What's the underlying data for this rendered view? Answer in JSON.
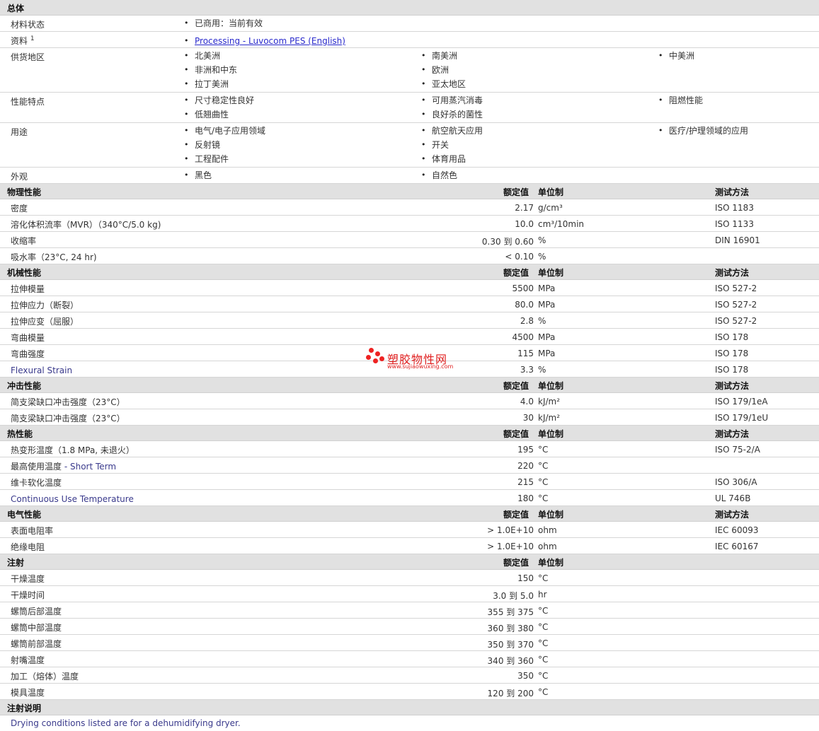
{
  "general": {
    "title": "总体",
    "status_label": "材料状态",
    "status_value": "已商用：当前有效",
    "docs_label": "资料",
    "docs_sup": "1",
    "docs_link": "Processing - Luvocom PES (English)",
    "supply_label": "供货地区",
    "supply": [
      "北美洲",
      "南美洲",
      "中美洲",
      "非洲和中东",
      "欧洲",
      "拉丁美洲",
      "亚太地区"
    ],
    "features_label": "性能特点",
    "features": [
      "尺寸稳定性良好",
      "可用蒸汽消毒",
      "阻燃性能",
      "低翘曲性",
      "良好杀的菌性"
    ],
    "uses_label": "用途",
    "uses": [
      "电气/电子应用领域",
      "航空航天应用",
      "医疗/护理领域的应用",
      "反射镜",
      "开关",
      "工程配件",
      "体育用品"
    ],
    "appearance_label": "外观",
    "appearance": [
      "黑色",
      "自然色"
    ]
  },
  "headers": {
    "nominal": "额定值",
    "unit": "单位制",
    "test": "测试方法"
  },
  "physical": {
    "title": "物理性能",
    "rows": [
      {
        "label": "密度",
        "value": "2.17",
        "unit": "g/cm³",
        "test": "ISO 1183"
      },
      {
        "label": "溶化体积流率（MVR）（340°C/5.0 kg)",
        "value": "10.0",
        "unit": "cm³/10min",
        "test": "ISO 1133"
      },
      {
        "label": "收缩率",
        "value": "0.30 到  0.60",
        "unit": "%",
        "test": "DIN 16901"
      },
      {
        "label": "吸水率（23°C, 24 hr)",
        "value": "< 0.10",
        "unit": "%",
        "test": ""
      }
    ]
  },
  "mechanical": {
    "title": "机械性能",
    "rows": [
      {
        "label": "拉伸模量",
        "value": "5500",
        "unit": "MPa",
        "test": "ISO 527-2"
      },
      {
        "label": "拉伸应力（断裂）",
        "value": "80.0",
        "unit": "MPa",
        "test": "ISO 527-2"
      },
      {
        "label": "拉伸应变（屈服）",
        "value": "2.8",
        "unit": "%",
        "test": "ISO 527-2"
      },
      {
        "label": "弯曲模量",
        "value": "4500",
        "unit": "MPa",
        "test": "ISO 178"
      },
      {
        "label": "弯曲强度",
        "value": "115",
        "unit": "MPa",
        "test": "ISO 178"
      },
      {
        "label": "Flexural Strain",
        "value": "3.3",
        "unit": "%",
        "test": "ISO 178"
      }
    ]
  },
  "impact": {
    "title": "冲击性能",
    "rows": [
      {
        "label": "简支梁缺口冲击强度（23°C）",
        "value": "4.0",
        "unit": "kJ/m²",
        "test": "ISO 179/1eA"
      },
      {
        "label": "简支梁缺口冲击强度（23°C）",
        "value": "30",
        "unit": "kJ/m²",
        "test": "ISO 179/1eU"
      }
    ]
  },
  "thermal": {
    "title": "热性能",
    "rows": [
      {
        "label": "热变形温度（1.8 MPa, 未退火）",
        "value": "195",
        "unit": "°C",
        "test": "ISO 75-2/A"
      },
      {
        "label": "最高使用温度",
        "label_extra": " - Short Term",
        "value": "220",
        "unit": "°C",
        "test": ""
      },
      {
        "label": "维卡软化温度",
        "value": "215",
        "unit": "°C",
        "test": "ISO 306/A"
      },
      {
        "label": "Continuous Use Temperature",
        "value": "180",
        "unit": "°C",
        "test": "UL 746B"
      }
    ]
  },
  "electrical": {
    "title": "电气性能",
    "rows": [
      {
        "label": "表面电阻率",
        "value": "> 1.0E+10",
        "unit": "ohm",
        "test": "IEC 60093"
      },
      {
        "label": "绝缘电阻",
        "value": "> 1.0E+10",
        "unit": "ohm",
        "test": "IEC 60167"
      }
    ]
  },
  "injection": {
    "title": "注射",
    "rows": [
      {
        "label": "干燥温度",
        "value": "150",
        "unit": "°C"
      },
      {
        "label": "干燥时间",
        "value": "3.0 到  5.0",
        "unit": "hr"
      },
      {
        "label": "螺筒后部温度",
        "value": "355 到  375",
        "unit": "°C"
      },
      {
        "label": "螺筒中部温度",
        "value": "360 到  380",
        "unit": "°C"
      },
      {
        "label": "螺筒前部温度",
        "value": "350 到  370",
        "unit": "°C"
      },
      {
        "label": "射嘴温度",
        "value": "340 到  360",
        "unit": "°C"
      },
      {
        "label": "加工（熔体）温度",
        "value": "350",
        "unit": "°C"
      },
      {
        "label": "模具温度",
        "value": "120 到  200",
        "unit": "°C"
      }
    ]
  },
  "notes": {
    "title": "注射说明",
    "text": "Drying conditions listed are for a dehumidifying dryer."
  },
  "watermark": {
    "name": "塑胶物性网",
    "url": "www.sujiaowuxing.com"
  }
}
